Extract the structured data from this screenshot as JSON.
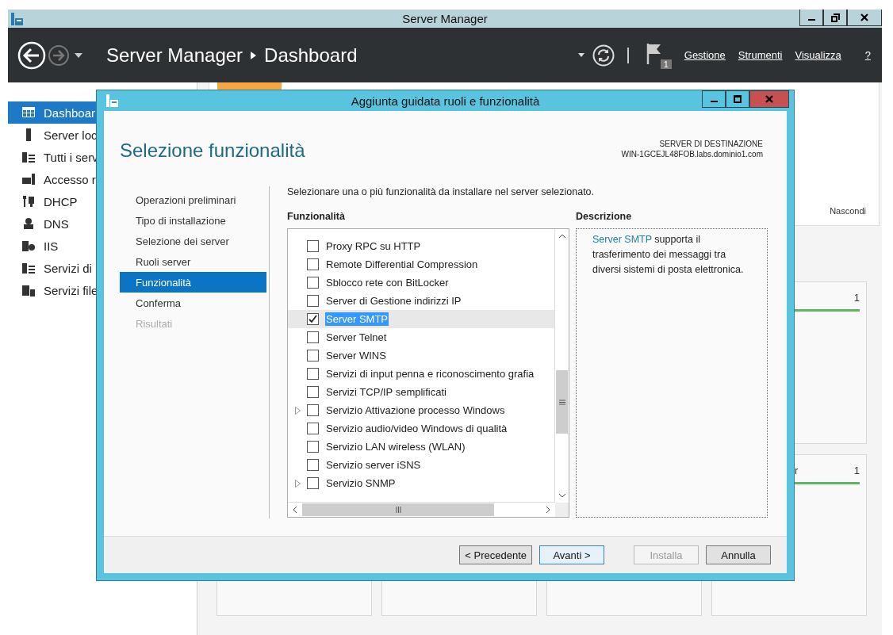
{
  "main_window": {
    "title": "Server Manager"
  },
  "header": {
    "breadcrumb": [
      "Server Manager",
      "Dashboard"
    ],
    "notification_count": "1",
    "menus": [
      "Gestione",
      "Strumenti",
      "Visualizza",
      "?"
    ]
  },
  "sidebar": {
    "items": [
      {
        "label": "Dashboar",
        "selected": true
      },
      {
        "label": "Server loc",
        "selected": false
      },
      {
        "label": "Tutti i serv",
        "selected": false
      },
      {
        "label": "Accesso r",
        "selected": false
      },
      {
        "label": "DHCP",
        "selected": false
      },
      {
        "label": "DNS",
        "selected": false
      },
      {
        "label": "IIS",
        "selected": false
      },
      {
        "label": "Servizi di",
        "selected": false
      },
      {
        "label": "Servizi file",
        "selected": false
      }
    ]
  },
  "welcome": {
    "hide_link": "Nascondi"
  },
  "tiles": [
    {
      "count": "1"
    },
    {
      "title": "r",
      "count": "1"
    }
  ],
  "dialog": {
    "title": "Aggiunta guidata ruoli e funzionalità",
    "heading": "Selezione funzionalità",
    "destination_label": "SERVER DI DESTINAZIONE",
    "destination_server": "WIN-1GCEJL48FOB.labs.dominio1.com",
    "steps": [
      {
        "label": "Operazioni preliminari",
        "selected": false,
        "disabled": false
      },
      {
        "label": "Tipo di installazione",
        "selected": false,
        "disabled": false
      },
      {
        "label": "Selezione dei server",
        "selected": false,
        "disabled": false
      },
      {
        "label": "Ruoli server",
        "selected": false,
        "disabled": false
      },
      {
        "label": "Funzionalità",
        "selected": true,
        "disabled": false
      },
      {
        "label": "Conferma",
        "selected": false,
        "disabled": false
      },
      {
        "label": "Risultati",
        "selected": false,
        "disabled": true
      }
    ],
    "instruction": "Selezionare una o più funzionalità da installare nel server selezionato.",
    "features_label": "Funzionalità",
    "features": [
      {
        "label": "Proxy RPC su HTTP",
        "checked": false,
        "selected": false,
        "expandable": false
      },
      {
        "label": "Remote Differential Compression",
        "checked": false,
        "selected": false,
        "expandable": false
      },
      {
        "label": "Sblocco rete con BitLocker",
        "checked": false,
        "selected": false,
        "expandable": false
      },
      {
        "label": "Server di Gestione indirizzi IP",
        "checked": false,
        "selected": false,
        "expandable": false
      },
      {
        "label": "Server SMTP",
        "checked": true,
        "selected": true,
        "expandable": false
      },
      {
        "label": "Server Telnet",
        "checked": false,
        "selected": false,
        "expandable": false
      },
      {
        "label": "Server WINS",
        "checked": false,
        "selected": false,
        "expandable": false
      },
      {
        "label": "Servizi di input penna e riconoscimento grafia",
        "checked": false,
        "selected": false,
        "expandable": false
      },
      {
        "label": "Servizi TCP/IP semplificati",
        "checked": false,
        "selected": false,
        "expandable": false
      },
      {
        "label": "Servizio Attivazione processo Windows",
        "checked": false,
        "selected": false,
        "expandable": true
      },
      {
        "label": "Servizio audio/video Windows di qualità",
        "checked": false,
        "selected": false,
        "expandable": false
      },
      {
        "label": "Servizio LAN wireless (WLAN)",
        "checked": false,
        "selected": false,
        "expandable": false
      },
      {
        "label": "Servizio server iSNS",
        "checked": false,
        "selected": false,
        "expandable": false
      },
      {
        "label": "Servizio SNMP",
        "checked": false,
        "selected": false,
        "expandable": true
      }
    ],
    "description_label": "Descrizione",
    "description": {
      "link": "Server SMTP",
      "text": " supporta il trasferimento dei messaggi tra diversi sistemi di posta elettronica."
    },
    "buttons": [
      {
        "label": "< Precedente",
        "default": false,
        "disabled": false
      },
      {
        "label": "Avanti >",
        "default": true,
        "disabled": false
      },
      {
        "label": "Installa",
        "default": false,
        "disabled": true
      },
      {
        "label": "Annulla",
        "default": false,
        "disabled": false
      }
    ]
  }
}
